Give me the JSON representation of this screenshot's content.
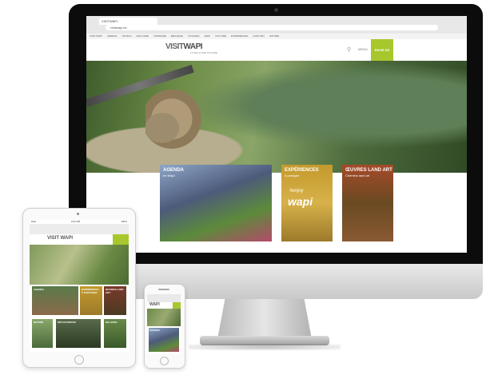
{
  "desktop": {
    "browser_tab": "VISITWAPI",
    "url": "visitwapi.be",
    "bookmarks": [
      "VISIT WAPI",
      "AGENDA",
      "HOTELS",
      "WALLONIE",
      "TOURISME",
      "BELGIQUE",
      "VOYAGES",
      "WAPI",
      "CULTURE",
      "EXPERIENCES",
      "LAND ART",
      "NATURE"
    ],
    "logo_prefix": "VISIT",
    "logo_main": "WAPI",
    "tagline": "LA WALLONIE PICARDE",
    "menu_label": "MENU",
    "cta_label": "ENVIE DE",
    "cards": [
      {
        "title": "AGENDA",
        "subtitle": "en Wapi"
      },
      {
        "title": "EXPÉRIENCES",
        "subtitle": "à partager",
        "enjoy": "#enjoy",
        "brand": "wapi"
      },
      {
        "title": "ŒUVRES LAND ART",
        "subtitle": "Chemins land art"
      }
    ]
  },
  "tablet": {
    "status_left": "iPad",
    "status_time": "9:41 PM",
    "status_right": "100%",
    "logo": "VISIT WAPI",
    "tiles_top": [
      "AGENDA",
      "EXPÉRIENCES À PARTAGER",
      "ŒUVRES LAND ART"
    ],
    "tiles_bottom": [
      "NATURE",
      "DÉCOUVERTES",
      "BALADES"
    ]
  },
  "phone": {
    "logo": "WAPI",
    "card_title": "AGENDA"
  },
  "colors": {
    "accent_green": "#a7c72d",
    "bezel": "#0c0c0c"
  },
  "icons": [
    "search-icon",
    "camera-icon",
    "home-button-icon"
  ]
}
